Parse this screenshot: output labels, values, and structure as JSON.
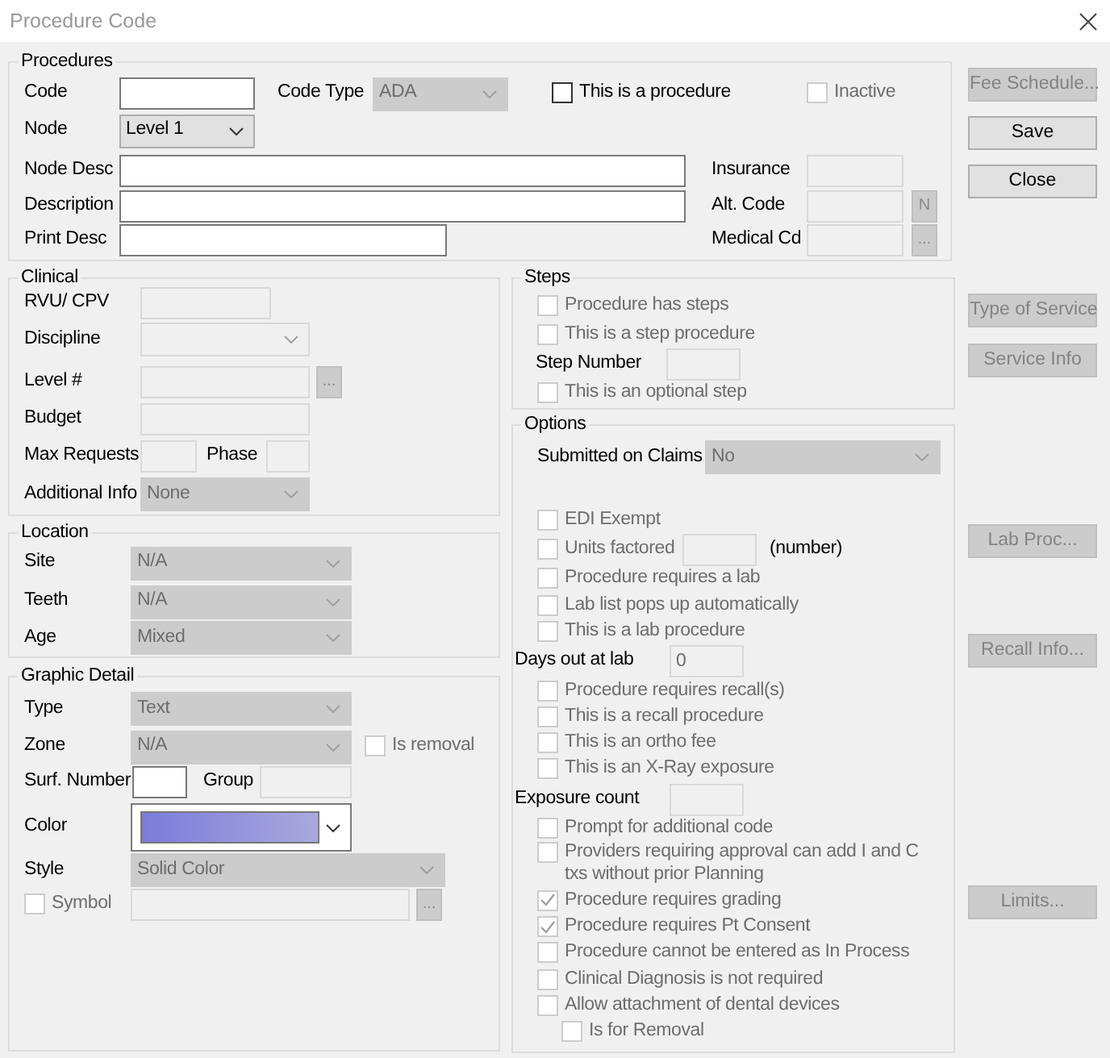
{
  "window": {
    "title": "Procedure Code"
  },
  "procedures": {
    "legend": "Procedures",
    "rows": [
      [
        {
          "kind": "label",
          "text": "Code"
        },
        {
          "kind": "input",
          "disabled": false
        },
        {
          "kind": "label",
          "text": "Code Type"
        },
        {
          "kind": "select",
          "value": "ADA",
          "disabled": true
        },
        {
          "kind": "checkbox",
          "text": "This is a procedure",
          "checked": false,
          "disabled": false
        },
        {
          "kind": "checkbox",
          "text": "Inactive",
          "checked": false,
          "disabled": true
        }
      ],
      [
        {
          "kind": "label",
          "text": "Node"
        },
        {
          "kind": "select",
          "value": "Level 1",
          "disabled": false
        }
      ],
      [
        {
          "kind": "label",
          "text": "Node Desc"
        },
        {
          "kind": "input",
          "disabled": false
        },
        {
          "kind": "label",
          "text": "Insurance"
        },
        {
          "kind": "input",
          "disabled": true
        }
      ],
      [
        {
          "kind": "label",
          "text": "Description"
        },
        {
          "kind": "input",
          "disabled": false
        },
        {
          "kind": "label",
          "text": "Alt. Code"
        },
        {
          "kind": "input",
          "disabled": true
        },
        {
          "kind": "button",
          "text": "N",
          "disabled": true
        }
      ],
      [
        {
          "kind": "label",
          "text": "Print Desc"
        },
        {
          "kind": "input",
          "disabled": false
        },
        {
          "kind": "label",
          "text": "Medical Cd"
        },
        {
          "kind": "input",
          "disabled": true
        },
        {
          "kind": "button",
          "text": "...",
          "disabled": true
        }
      ]
    ]
  },
  "clinical": {
    "legend": "Clinical",
    "rows": [
      [
        {
          "kind": "label",
          "text": "RVU/ CPV"
        },
        {
          "kind": "input",
          "disabled": true
        }
      ],
      [
        {
          "kind": "label",
          "text": "Discipline"
        },
        {
          "kind": "combo",
          "disabled": true
        }
      ],
      [
        {
          "kind": "label",
          "text": "Level #"
        },
        {
          "kind": "input",
          "disabled": true
        },
        {
          "kind": "button",
          "text": "...",
          "disabled": true
        }
      ],
      [
        {
          "kind": "label",
          "text": "Budget"
        },
        {
          "kind": "input",
          "disabled": true
        }
      ],
      [
        {
          "kind": "label",
          "text": "Max Requests"
        },
        {
          "kind": "input",
          "disabled": true
        },
        {
          "kind": "label",
          "text": "Phase"
        },
        {
          "kind": "input",
          "disabled": true
        }
      ],
      [
        {
          "kind": "label",
          "text": "Additional Info"
        },
        {
          "kind": "select",
          "value": "None",
          "disabled": true
        }
      ]
    ]
  },
  "location": {
    "legend": "Location",
    "rows": [
      [
        {
          "kind": "label",
          "text": "Site"
        },
        {
          "kind": "select",
          "value": "N/A",
          "disabled": true
        }
      ],
      [
        {
          "kind": "label",
          "text": "Teeth"
        },
        {
          "kind": "select",
          "value": "N/A",
          "disabled": true
        }
      ],
      [
        {
          "kind": "label",
          "text": "Age"
        },
        {
          "kind": "select",
          "value": "Mixed",
          "disabled": true
        }
      ]
    ]
  },
  "graphic_detail": {
    "legend": "Graphic Detail",
    "rows": [
      [
        {
          "kind": "label",
          "text": "Type"
        },
        {
          "kind": "select",
          "value": "Text",
          "disabled": true
        }
      ],
      [
        {
          "kind": "label",
          "text": "Zone"
        },
        {
          "kind": "select",
          "value": "N/A",
          "disabled": true
        },
        {
          "kind": "checkbox",
          "text": "Is removal",
          "checked": false,
          "disabled": true
        }
      ],
      [
        {
          "kind": "label",
          "text": "Surf. Number"
        },
        {
          "kind": "input",
          "disabled": false
        },
        {
          "kind": "label",
          "text": "Group"
        },
        {
          "kind": "input",
          "disabled": true
        }
      ],
      [
        {
          "kind": "label",
          "text": "Color"
        },
        {
          "kind": "color",
          "disabled": false
        }
      ],
      [
        {
          "kind": "label",
          "text": "Style"
        },
        {
          "kind": "select",
          "value": "Solid Color",
          "disabled": true
        }
      ],
      [
        {
          "kind": "checkbox",
          "text": "Symbol",
          "checked": false,
          "disabled": true
        },
        {
          "kind": "input",
          "disabled": true
        },
        {
          "kind": "button",
          "text": "...",
          "disabled": true
        }
      ]
    ]
  },
  "steps": {
    "legend": "Steps",
    "rows": [
      [
        {
          "kind": "checkbox",
          "text": "Procedure has steps",
          "checked": false,
          "disabled": true
        }
      ],
      [
        {
          "kind": "checkbox",
          "text": "This is a step procedure",
          "checked": false,
          "disabled": true
        }
      ],
      [
        {
          "kind": "label",
          "text": "Step Number"
        },
        {
          "kind": "input",
          "disabled": true
        }
      ],
      [
        {
          "kind": "checkbox",
          "text": "This is an optional step",
          "checked": false,
          "disabled": true
        }
      ]
    ]
  },
  "options": {
    "legend": "Options",
    "items": [
      {
        "kind": "select_field",
        "label": "Submitted on Claims",
        "value": "No",
        "disabled": true
      },
      {
        "kind": "checkbox",
        "text": "EDI Exempt",
        "checked": false,
        "disabled": true
      },
      {
        "kind": "checkbox",
        "text": "Units factored",
        "checked": false,
        "disabled": true,
        "field": {
          "disabled": true
        },
        "unit": "(number)"
      },
      {
        "kind": "checkbox",
        "text": "Procedure requires a lab",
        "checked": false,
        "disabled": true
      },
      {
        "kind": "checkbox",
        "text": "Lab list pops up automatically",
        "checked": false,
        "disabled": true
      },
      {
        "kind": "checkbox",
        "text": "This is a lab procedure",
        "checked": false,
        "disabled": true
      },
      {
        "kind": "text_field",
        "label": "Days out at lab",
        "value": "0",
        "disabled": true
      },
      {
        "kind": "checkbox",
        "text": "Procedure requires recall(s)",
        "checked": false,
        "disabled": true
      },
      {
        "kind": "checkbox",
        "text": "This is a recall procedure",
        "checked": false,
        "disabled": true
      },
      {
        "kind": "checkbox",
        "text": "This is an ortho fee",
        "checked": false,
        "disabled": true
      },
      {
        "kind": "checkbox",
        "text": "This is an X-Ray exposure",
        "checked": false,
        "disabled": true
      },
      {
        "kind": "text_field",
        "label": "Exposure count",
        "disabled": true
      },
      {
        "kind": "checkbox",
        "text": "Prompt for additional code",
        "checked": false,
        "disabled": true
      },
      {
        "kind": "checkbox",
        "text": "Providers requiring approval can add I and C txs without prior Planning",
        "checked": false,
        "disabled": true
      },
      {
        "kind": "checkbox",
        "text": "Procedure requires grading",
        "checked": true,
        "disabled": true
      },
      {
        "kind": "checkbox",
        "text": "Procedure requires Pt Consent",
        "checked": true,
        "disabled": true
      },
      {
        "kind": "checkbox",
        "text": "Procedure cannot be entered as In Process",
        "checked": false,
        "disabled": true
      },
      {
        "kind": "checkbox",
        "text": "Clinical Diagnosis is not required",
        "checked": false,
        "disabled": true
      },
      {
        "kind": "checkbox",
        "text": "Allow attachment of dental devices",
        "checked": false,
        "disabled": true,
        "children": [
          {
            "kind": "checkbox",
            "text": "Is for Removal",
            "checked": false,
            "disabled": true
          }
        ]
      }
    ]
  },
  "buttons": [
    {
      "text": "Fee Schedule...",
      "disabled": true
    },
    {
      "text": "Save",
      "disabled": false
    },
    {
      "text": "Close",
      "disabled": false
    },
    {
      "text": "Type of Service",
      "disabled": true
    },
    {
      "text": "Service Info",
      "disabled": true
    },
    {
      "text": "Lab Proc...",
      "disabled": true
    },
    {
      "text": "Recall Info...",
      "disabled": true
    },
    {
      "text": "Limits...",
      "disabled": true
    }
  ]
}
